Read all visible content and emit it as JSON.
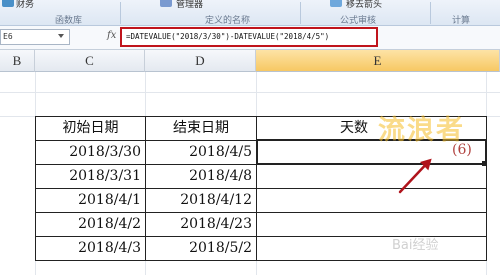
{
  "ribbon": {
    "top_items": [
      "财务",
      "管理器",
      "移去箭头"
    ],
    "group_labels": [
      "函数库",
      "定义的名称",
      "公式审核",
      "计算"
    ]
  },
  "formula_bar": {
    "name_box": "E6",
    "fx_label": "fx",
    "formula": "=DATEVALUE(\"2018/3/30\")-DATEVALUE(\"2018/4/5\")"
  },
  "columns": [
    "B",
    "C",
    "D",
    "E"
  ],
  "selected_column": "E",
  "table": {
    "headers": [
      "初始日期",
      "结束日期",
      "天数"
    ],
    "rows": [
      [
        "2018/3/30",
        "2018/4/5"
      ],
      [
        "2018/3/31",
        "2018/4/8"
      ],
      [
        "2018/4/1",
        "2018/4/12"
      ],
      [
        "2018/4/2",
        "2018/4/23"
      ],
      [
        "2018/4/3",
        "2018/5/2"
      ]
    ]
  },
  "active_cell_value": "(6)",
  "watermark_text": "流浪者",
  "bottom_watermark": "Bai经验",
  "colors": {
    "formula_highlight": "#c0141c",
    "selected_column_header": "#f7c863",
    "annotation_arrow": "#b0141c"
  },
  "icons": [
    "dropdown-arrow-icon",
    "fx-icon",
    "annotation-arrow-icon"
  ]
}
